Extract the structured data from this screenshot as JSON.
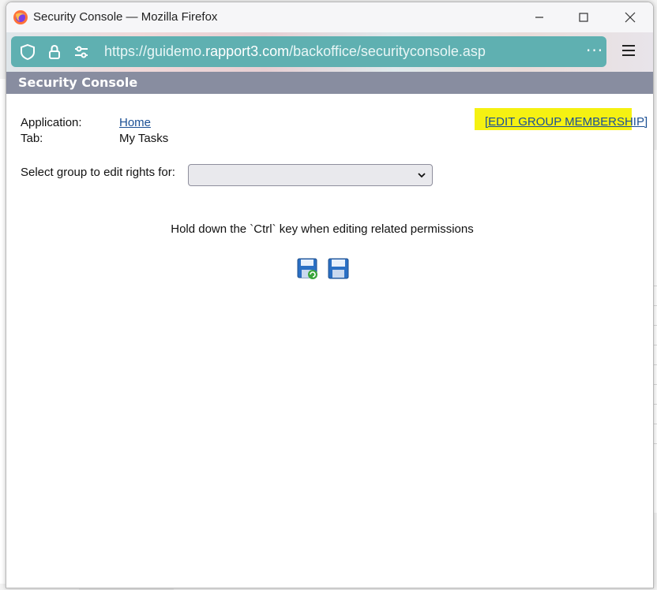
{
  "window": {
    "title": "Security Console — Mozilla Firefox"
  },
  "urlbar": {
    "prefix": "https://guidemo.",
    "domain": "rapport3.com",
    "path": "/backoffice/securityconsole.asp",
    "more_label": "···"
  },
  "page": {
    "title": "Security Console",
    "application_label": "Application:",
    "application_value": "Home",
    "tab_label": "Tab:",
    "tab_value": "My Tasks",
    "edit_group_link": "[EDIT GROUP MEMBERSHIP]",
    "group_select_label": "Select group to edit rights for:",
    "group_select_value": "",
    "hint": "Hold down the `Ctrl` key when editing related permissions",
    "highlight_color": "#f5f112",
    "header_color": "#888da0",
    "link_color": "#1a4f94"
  },
  "icons": {
    "save_apply": "save-and-refresh-icon",
    "save": "save-icon"
  }
}
